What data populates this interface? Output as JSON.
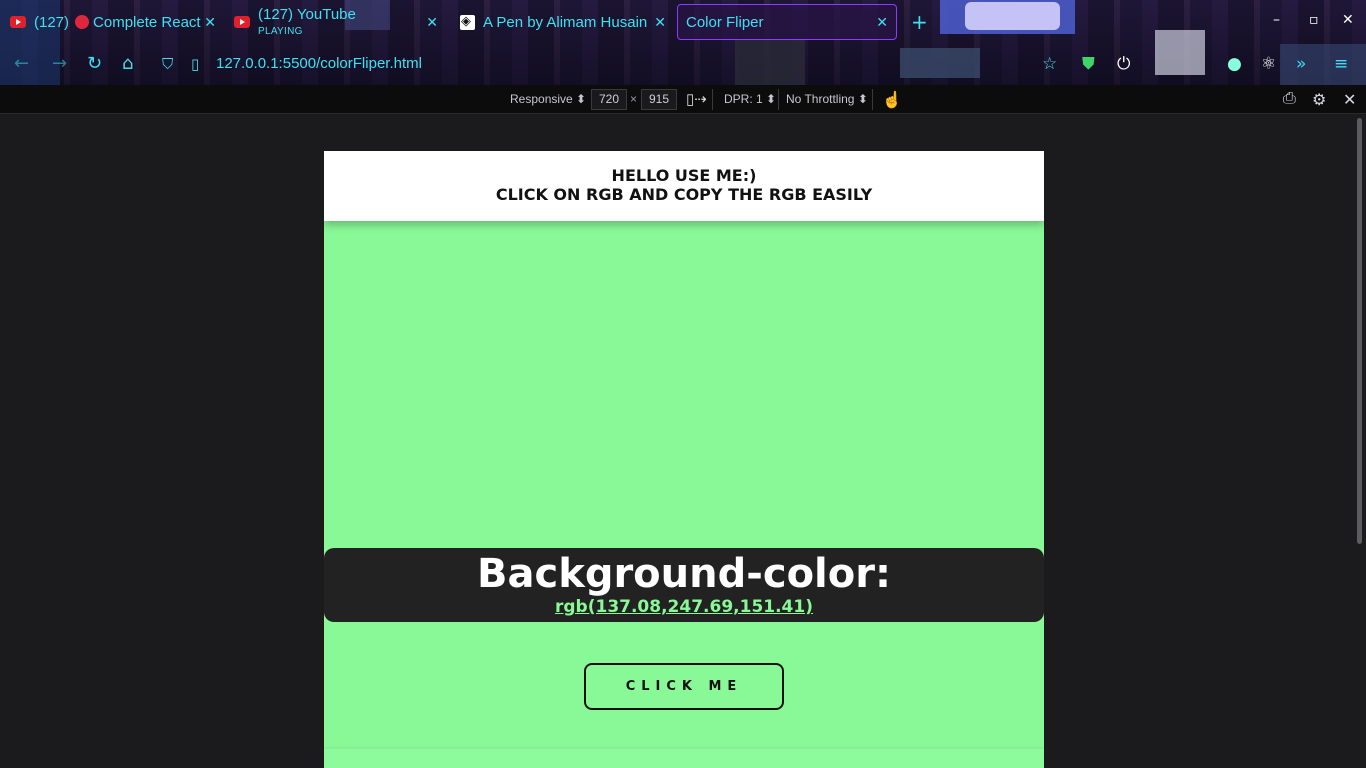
{
  "browser": {
    "tabs": [
      {
        "label": "(127) 🔴 Complete React",
        "icon": "youtube-icon",
        "playing": ""
      },
      {
        "label": "(127) YouTube",
        "icon": "youtube-icon",
        "playing": "PLAYING"
      },
      {
        "label": "A Pen by Alimam Husain",
        "icon": "codepen-icon",
        "playing": ""
      },
      {
        "label": "Color Fliper",
        "icon": "",
        "playing": ""
      }
    ],
    "tab_prefix_1": "(127)",
    "tab_suffix_1": "Complete React",
    "url": "127.0.0.1:5500/colorFliper.html",
    "accent_color": "#3fe0f0"
  },
  "devtools": {
    "device": "Responsive",
    "width": "720",
    "times": "×",
    "height": "915",
    "dpr": "DPR: 1",
    "throttling": "No Throttling"
  },
  "page": {
    "header_line1": "HELLO USE ME:)",
    "header_line2": "CLICK ON RGB AND COPY THE RGB EASILY",
    "bg_label": "Background-color:",
    "rgb_value": "rgb(137.08,247.69,151.41)",
    "button_label": "CLICK ME",
    "background_color": "#89f997"
  }
}
